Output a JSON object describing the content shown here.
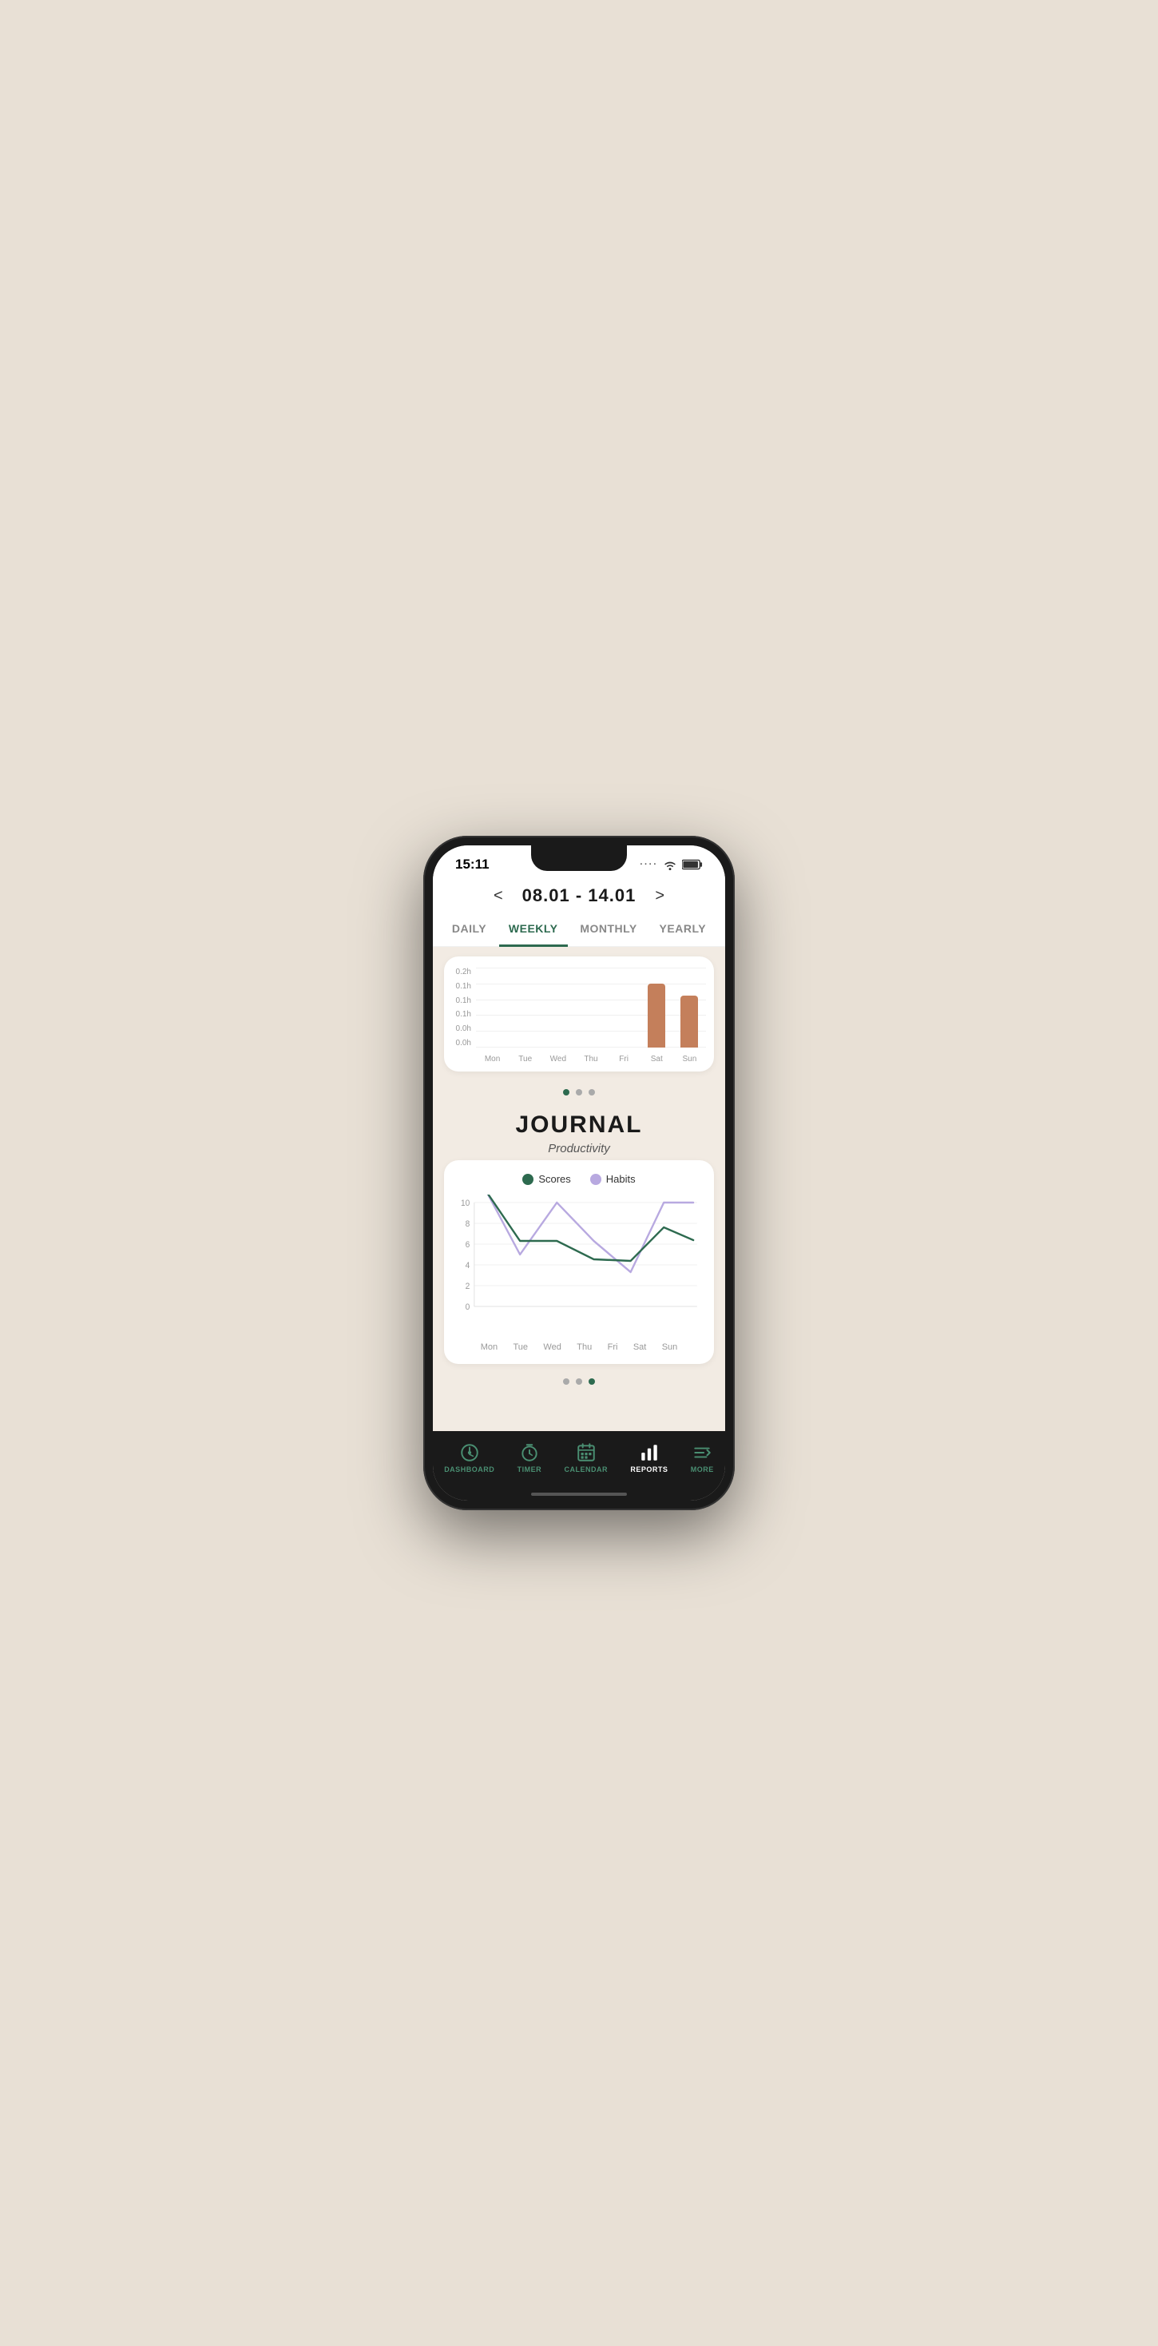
{
  "statusBar": {
    "time": "15:11",
    "wifi": "wifi",
    "battery": "battery"
  },
  "header": {
    "prevArrow": "<",
    "nextArrow": ">",
    "dateRange": "08.01 - 14.01"
  },
  "tabs": [
    {
      "label": "DAILY",
      "active": false
    },
    {
      "label": "WEEKLY",
      "active": true
    },
    {
      "label": "MONTHLY",
      "active": false
    },
    {
      "label": "YEARLY",
      "active": false
    }
  ],
  "barChart": {
    "yLabels": [
      "0.2h",
      "0.1h",
      "0.1h",
      "0.1h",
      "0.0h",
      "0.0h"
    ],
    "days": [
      "Mon",
      "Tue",
      "Wed",
      "Thu",
      "Fri",
      "Sat",
      "Sun"
    ],
    "values": [
      0,
      0,
      0,
      0,
      0,
      85,
      70
    ],
    "maxHeight": 100,
    "barColor": "#c47f5b"
  },
  "pageIndicator1": {
    "dots": [
      true,
      false,
      false
    ]
  },
  "journalSection": {
    "title": "JOURNAL",
    "subtitle": "Productivity"
  },
  "lineChart": {
    "legend": [
      {
        "label": "Scores",
        "class": "scores"
      },
      {
        "label": "Habits",
        "class": "habits"
      }
    ],
    "days": [
      "Mon",
      "Tue",
      "Wed",
      "Thu",
      "Fri",
      "Sat",
      "Sun"
    ],
    "scoresData": [
      11,
      6.3,
      6.3,
      4.5,
      4.4,
      7.6,
      6.4
    ],
    "habitsData": [
      11,
      5,
      10,
      6.3,
      3.3,
      10,
      10
    ],
    "yLabels": [
      "10",
      "8",
      "6",
      "4",
      "2",
      "0"
    ]
  },
  "pageIndicator2": {
    "dots": [
      false,
      false,
      true
    ]
  },
  "bottomNav": [
    {
      "label": "DASHBOARD",
      "active": false,
      "icon": "dashboard"
    },
    {
      "label": "TIMER",
      "active": false,
      "icon": "timer"
    },
    {
      "label": "CALENDAR",
      "active": false,
      "icon": "calendar"
    },
    {
      "label": "REPORTS",
      "active": true,
      "icon": "reports"
    },
    {
      "label": "MORE",
      "active": false,
      "icon": "more"
    }
  ]
}
